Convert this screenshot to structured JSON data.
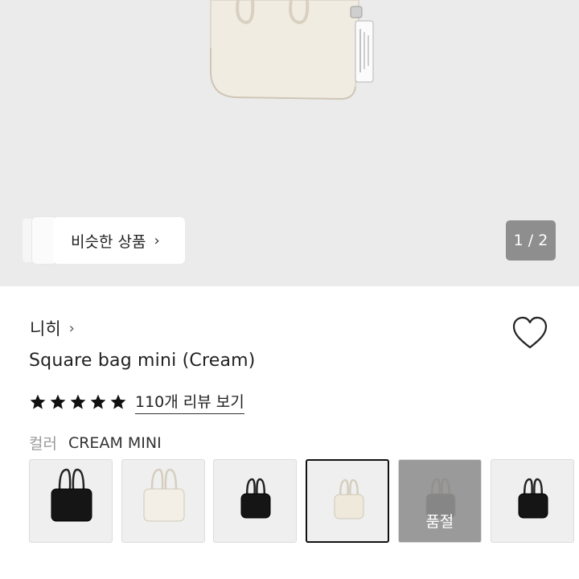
{
  "gallery": {
    "similar_label": "비슷한 상품",
    "chevron": "›",
    "counter": "1 / 2"
  },
  "product": {
    "brand": "니히",
    "brand_chevron": "›",
    "title": "Square bag mini (Cream)",
    "rating_stars": 5,
    "review_link": "110개 리뷰 보기",
    "color_label": "컬러",
    "color_value": "CREAM MINI"
  },
  "options": [
    {
      "name": "black",
      "bag_color": "#151515",
      "selected": false,
      "soldout": false
    },
    {
      "name": "cream",
      "bag_color": "#f3efe6",
      "selected": false,
      "soldout": false
    },
    {
      "name": "black-mini",
      "bag_color": "#151515",
      "selected": false,
      "soldout": false
    },
    {
      "name": "cream-mini",
      "bag_color": "#efe9db",
      "selected": true,
      "soldout": false
    },
    {
      "name": "grey",
      "bag_color": "#a8a8a8",
      "selected": false,
      "soldout": true,
      "soldout_label": "품절"
    },
    {
      "name": "black-small",
      "bag_color": "#151515",
      "selected": false,
      "soldout": false
    }
  ],
  "colors": {
    "hero_bg": "#ebebeb",
    "bag_cream": "#f0ebe1",
    "counter_bg": "#8e8e8e",
    "star": "#111111"
  },
  "icons": [
    "chevron-right-icon",
    "heart-icon",
    "star-icon"
  ]
}
